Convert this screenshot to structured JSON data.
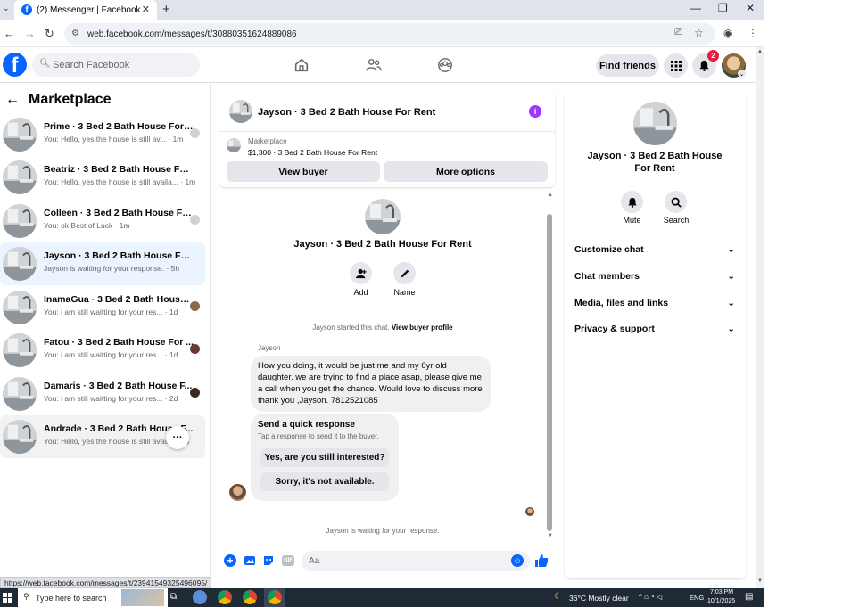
{
  "browser": {
    "tab_title": "(2) Messenger | Facebook",
    "tab_close": "✕",
    "new_tab": "+",
    "url": "web.facebook.com/messages/t/30880351624889086",
    "status_url": "https://web.facebook.com/messages/t/23941549325496095/"
  },
  "header": {
    "search_placeholder": "Search Facebook",
    "find_friends": "Find friends",
    "notification_count": "2"
  },
  "sidebar": {
    "title": "Marketplace",
    "conversations": [
      {
        "title": "Prime · 3 Bed 2 Bath House For ...",
        "snippet": "You: Hello, yes the house is still av... · 1m"
      },
      {
        "title": "Beatriz · 3 Bed 2 Bath House For R...",
        "snippet": "You: Hello, yes the house is still availa... · 1m"
      },
      {
        "title": "Colleen · 3 Bed 2 Bath House Fo...",
        "snippet": "You: ok Best of Luck · 1m"
      },
      {
        "title": "Jayson · 3 Bed 2 Bath House For R...",
        "snippet": "Jayson is waiting for your response. · 5h"
      },
      {
        "title": "InamaGua · 3 Bed 2 Bath House ...",
        "snippet": "You: i am still waitting for your res... · 1d"
      },
      {
        "title": "Fatou · 3 Bed 2 Bath House For ...",
        "snippet": "You: i am still waitting for your res... · 1d"
      },
      {
        "title": "Damaris · 3 Bed 2 Bath House F...",
        "snippet": "You: i am still waitting for your res... · 2d"
      },
      {
        "title": "Andrade · 3 Bed 2 Bath House F...",
        "snippet": "You: Hello, yes the house is still avail... · 2d"
      }
    ],
    "more_label": "···"
  },
  "chat": {
    "header_title": "Jayson · 3 Bed 2 Bath House For Rent",
    "marketplace_label": "Marketplace",
    "listing": "$1,300 · 3 Bed 2 Bath House For Rent",
    "view_buyer": "View buyer",
    "more_options": "More options",
    "profile_name": "Jayson · 3 Bed 2 Bath House For Rent",
    "add_label": "Add",
    "name_label": "Name",
    "started_text": "Jayson started this chat.",
    "view_profile_link": "View buyer profile",
    "sender": "Jayson",
    "message": "How you doing, it would be just me and my 6yr old daughter. we are trying to find a place asap, please give me a call when you get the chance. Would love to discuss more thank you ,Jayson. 7812521085",
    "quick_title": "Send a quick response",
    "quick_sub": "Tap a response to send it to the buyer.",
    "quick_options": [
      "Yes, are you still interested?",
      "Sorry, it's not available."
    ],
    "waiting_text": "Jayson is waiting for your response.",
    "input_placeholder": "Aa"
  },
  "right_panel": {
    "name": "Jayson · 3 Bed 2 Bath House For Rent",
    "mute": "Mute",
    "search": "Search",
    "sections": [
      "Customize chat",
      "Chat members",
      "Media, files and links",
      "Privacy & support"
    ]
  },
  "taskbar": {
    "search_placeholder": "Type here to search",
    "weather": "36°C  Mostly clear",
    "lang": "ENG",
    "time": "7:03 PM",
    "date": "10/1/2025"
  },
  "colors": {
    "fb_blue": "#0866ff",
    "accent_purple": "#a033ff",
    "active_bg": "#ebf5ff"
  }
}
